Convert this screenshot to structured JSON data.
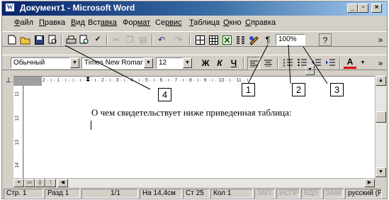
{
  "window": {
    "title": "Документ1 - Microsoft Word",
    "app_icon": "word-document-icon",
    "controls": [
      "minimize-icon",
      "restore-icon",
      "close-icon"
    ]
  },
  "menu": [
    {
      "first": "Ф",
      "rest": "айл"
    },
    {
      "first": "П",
      "rest": "равка"
    },
    {
      "first": "В",
      "rest": "ид"
    },
    {
      "first": "Вст",
      "rest": "авка"
    },
    {
      "first": "Фор",
      "rest": "мат"
    },
    {
      "first": "Се",
      "rest": "рвис"
    },
    {
      "first": "Т",
      "rest": "аблица"
    },
    {
      "first": "О",
      "rest": "кно"
    },
    {
      "first": "С",
      "rest": "правка"
    }
  ],
  "standard_toolbar": {
    "buttons": [
      "new-icon",
      "open-icon",
      "save-icon",
      "print-preview-icon",
      "print-icon",
      "preview-icon",
      "spelling-icon",
      "cut-icon",
      "copy-icon",
      "paste-icon",
      "undo-icon",
      "redo-icon",
      "tables-borders-icon",
      "insert-table-icon",
      "insert-excel-icon",
      "columns-icon",
      "drawing-icon",
      "show-hide-icon",
      "help-icon"
    ],
    "pilcrow": "¶",
    "zoom": "100%",
    "help": "?",
    "overflow": "»"
  },
  "format_toolbar": {
    "style": "Обычный",
    "font": "Times New Roman",
    "size": "12",
    "bold": "Ж",
    "italic": "К",
    "underline": "Ч",
    "font_color_letter": "А",
    "overflow": "»"
  },
  "ruler": {
    "text": "· 2 · ı · 1 · ı · ⌂ · ı · 1 · ı · 2 · ı · 3 · ı · 4 · ı · 5 · ı · 6 · ı · 7 · ı · 8 · ı · 9 · ı · 10 · ı · 11 · ı"
  },
  "vertical_ruler": [
    "11",
    "12",
    "13",
    "14"
  ],
  "document": {
    "text": "О чем свидетельствует ниже приведенная таблица:"
  },
  "callouts": [
    "1",
    "2",
    "3",
    "4"
  ],
  "statusbar": {
    "page": "Стр. 1",
    "section": "Разд 1",
    "pages": "1/1",
    "position": "На 14,4см",
    "line": "Ст 25",
    "column": "Кол 1",
    "rec": "ЗАП",
    "trk": "ИСПР",
    "ext": "ВДЛ",
    "ovr": "ЗАМ",
    "language": "русский (Р"
  },
  "colors": {
    "title_gradient_start": "#0a246a",
    "title_gradient_end": "#a6caf0",
    "chrome": "#d4d0c8"
  }
}
